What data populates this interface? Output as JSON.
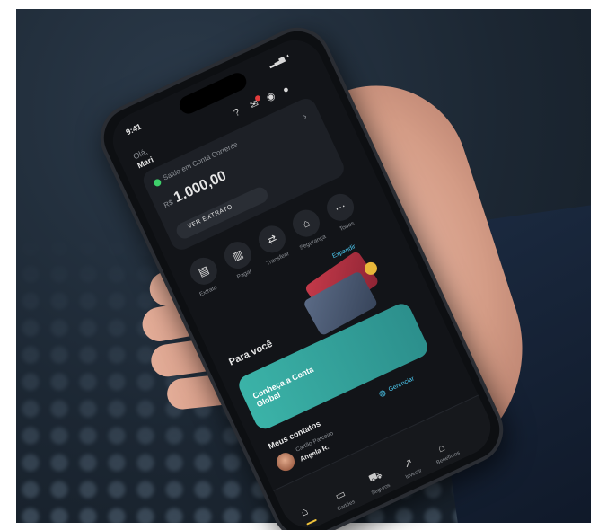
{
  "phone": {
    "status_time": "9:41",
    "greeting": "Olá,",
    "user_name": "Mari",
    "balance_label": "Saldo em Conta Corrente",
    "currency": "R$",
    "balance_value": "1.000,00",
    "statement_button": "VER EXTRATO",
    "actions": [
      {
        "label": "Extrato",
        "icon": "document-icon"
      },
      {
        "label": "Pagar",
        "icon": "barcode-icon"
      },
      {
        "label": "Transferir",
        "icon": "arrows-icon"
      },
      {
        "label": "Segurança",
        "icon": "lock-icon"
      },
      {
        "label": "Todos",
        "icon": "more-icon"
      }
    ],
    "section_for_you": "Para você",
    "section_for_you_link": "Expandir",
    "promo_title": "Conheça a Conta Global",
    "contacts_title": "Meus contatos",
    "contacts_link": "Gerenciar",
    "contact_role": "Cartão Parceiro",
    "contact_name": "Angela R.",
    "nav": [
      {
        "label": "",
        "icon": "home-icon"
      },
      {
        "label": "Cartões",
        "icon": "card-icon"
      },
      {
        "label": "Seguros",
        "icon": "car-icon"
      },
      {
        "label": "Investir",
        "icon": "chart-icon"
      },
      {
        "label": "Benefícios",
        "icon": "bank-icon"
      }
    ],
    "accent_color": "#4cc9f0",
    "promo_color": "#3bb3a8"
  }
}
